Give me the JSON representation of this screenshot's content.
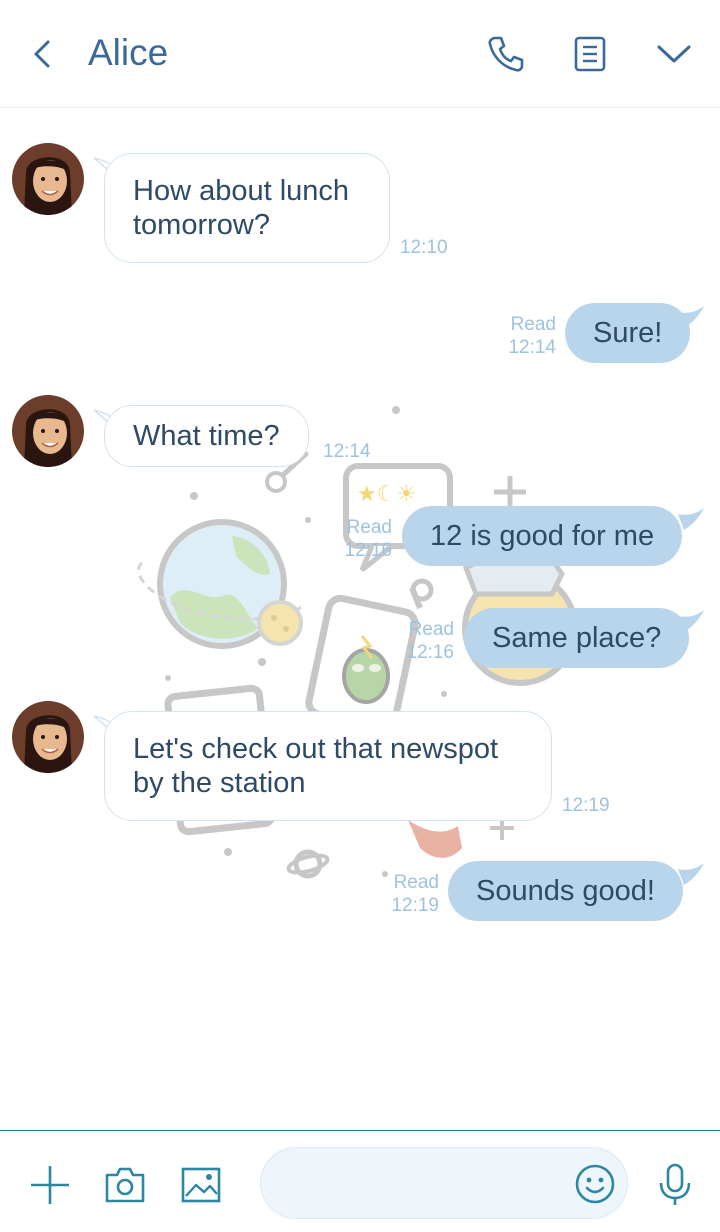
{
  "header": {
    "title": "Alice",
    "back_icon": "chevron-left-icon",
    "call_icon": "phone-icon",
    "notes_icon": "notes-icon",
    "menu_icon": "chevron-down-icon"
  },
  "colors": {
    "accent": "#3b6a9a",
    "outgoing_bubble": "#b9d5ec",
    "meta_text": "#9ec2df",
    "footer_border": "#2a7a86"
  },
  "messages": [
    {
      "direction": "in",
      "text": "How about lunch tomorrow?",
      "time": "12:10"
    },
    {
      "direction": "out",
      "text": "Sure!",
      "status": "Read",
      "time": "12:14"
    },
    {
      "direction": "in",
      "text": "What time?",
      "time": "12:14"
    },
    {
      "direction": "out",
      "text": "12 is good for me",
      "status": "Read",
      "time": "12:16"
    },
    {
      "direction": "out",
      "text": "Same place?",
      "status": "Read",
      "time": "12:16"
    },
    {
      "direction": "in",
      "text": "Let's check out that newspot by the station",
      "time": "12:19"
    },
    {
      "direction": "out",
      "text": "Sounds good!",
      "status": "Read",
      "time": "12:19"
    }
  ],
  "footer": {
    "add_icon": "plus-icon",
    "camera_icon": "camera-icon",
    "gallery_icon": "image-icon",
    "input_value": "",
    "input_placeholder": "",
    "emoji_icon": "smiley-icon",
    "mic_icon": "microphone-icon"
  }
}
